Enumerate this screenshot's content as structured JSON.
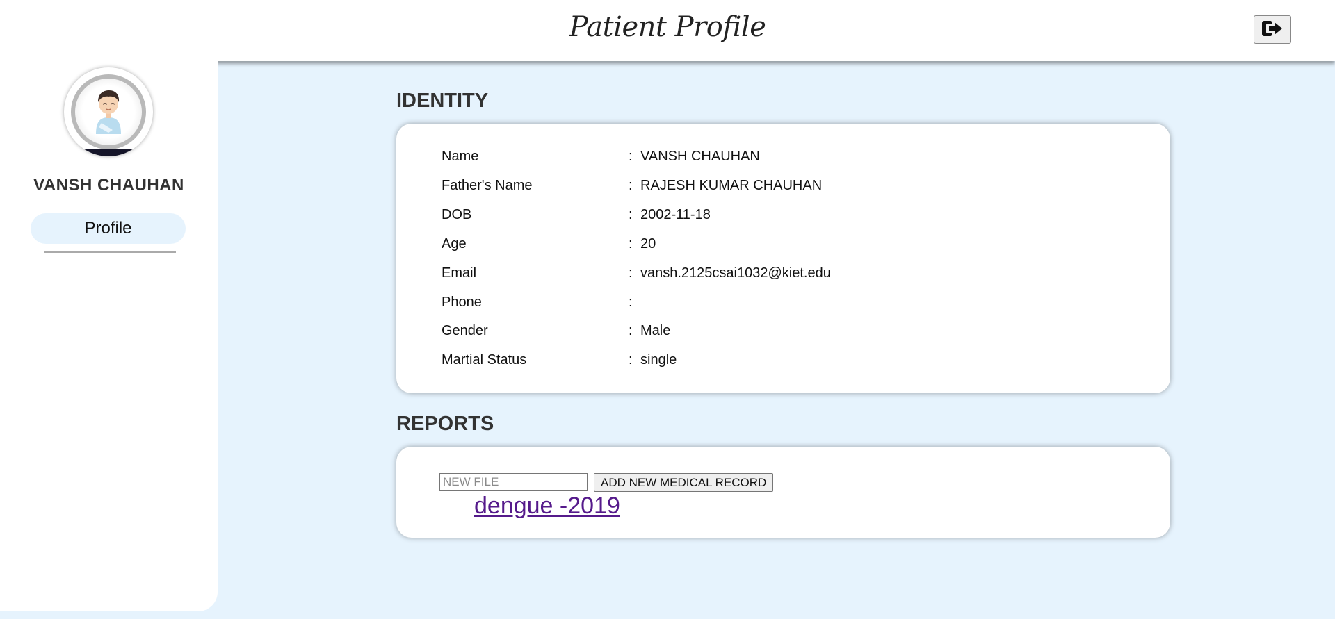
{
  "header": {
    "title": "Patient Profile",
    "logout_icon": "sign-out-icon"
  },
  "sidebar": {
    "avatar_icon": "patient-avatar-icon",
    "user_name": "VANSH CHAUHAN",
    "nav_items": [
      {
        "label": "Profile",
        "active": true
      }
    ]
  },
  "identity": {
    "heading": "IDENTITY",
    "separator": ":",
    "rows": [
      {
        "label": "Name",
        "value": "VANSH CHAUHAN"
      },
      {
        "label": "Father's Name",
        "value": "RAJESH KUMAR CHAUHAN"
      },
      {
        "label": "DOB",
        "value": "2002-11-18"
      },
      {
        "label": "Age",
        "value": "20"
      },
      {
        "label": "Email",
        "value": "vansh.2125csai1032@kiet.edu"
      },
      {
        "label": "Phone",
        "value": ""
      },
      {
        "label": "Gender",
        "value": "Male"
      },
      {
        "label": "Martial Status",
        "value": "single"
      }
    ]
  },
  "reports": {
    "heading": "REPORTS",
    "file_input": {
      "placeholder": "NEW FILE",
      "value": ""
    },
    "add_button_label": "ADD NEW MEDICAL RECORD",
    "records": [
      {
        "label": "dengue -2019"
      }
    ]
  },
  "colors": {
    "page_bg": "#e6f3fd",
    "panel_bg": "#ffffff",
    "link": "#551a8b",
    "heading_text": "#333333"
  }
}
